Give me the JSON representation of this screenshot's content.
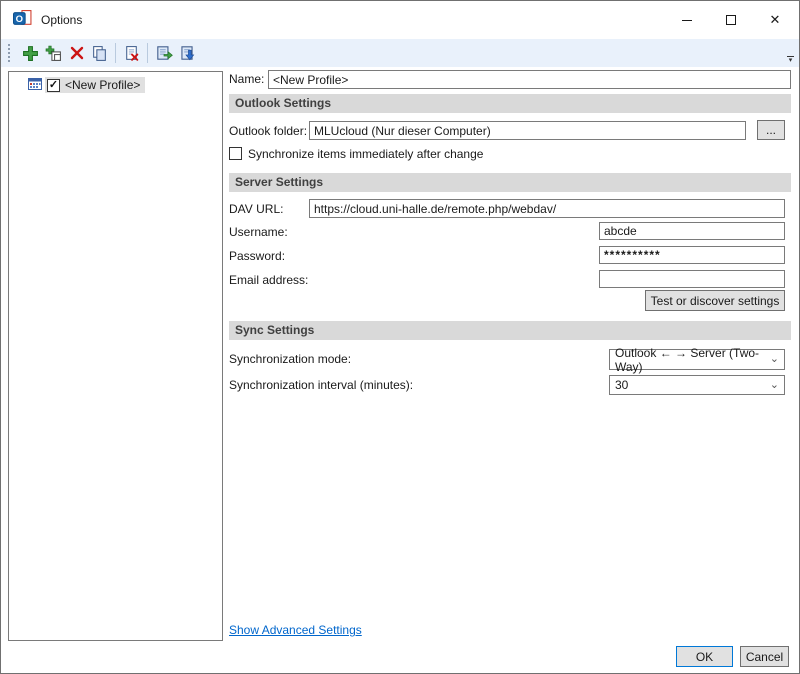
{
  "icons": {
    "check": "✓",
    "chevron_down": "⌄",
    "overflow_arrow": "▾",
    "minimize": "",
    "close": "✕"
  },
  "titlebar": {
    "title": "Options"
  },
  "toolbar": {
    "buttons": [
      {
        "name": "add-profile-icon"
      },
      {
        "name": "add-multiple-profiles-icon"
      },
      {
        "name": "delete-profile-icon"
      },
      {
        "name": "copy-profile-icon"
      },
      {
        "name": "clear-cache-icon"
      },
      {
        "name": "export-profiles-icon"
      },
      {
        "name": "import-profiles-icon"
      }
    ]
  },
  "profiles_panel": {
    "items": [
      {
        "label": "<New Profile>",
        "checked": true
      }
    ]
  },
  "form": {
    "name_label": "Name:",
    "name_value": "<New Profile>",
    "outlook": {
      "title": "Outlook Settings",
      "folder_label": "Outlook folder:",
      "folder_value": "MLUcloud (Nur dieser Computer)",
      "browse_label": "...",
      "sync_immediately_label": "Synchronize items immediately after change",
      "sync_immediately_checked": false
    },
    "server": {
      "title": "Server Settings",
      "dav_url_label": "DAV URL:",
      "dav_url_value": "https://cloud.uni-halle.de/remote.php/webdav/",
      "username_label": "Username:",
      "username_value": "abcde",
      "password_label": "Password:",
      "password_value": "**********",
      "email_label": "Email address:",
      "email_value": "",
      "test_button_label": "Test or discover settings"
    },
    "sync": {
      "title": "Sync Settings",
      "mode_label": "Synchronization mode:",
      "mode_value": "Outlook ← → Server (Two-Way)",
      "interval_label": "Synchronization interval (minutes):",
      "interval_value": "30"
    },
    "advanced_link_label": "Show Advanced Settings"
  },
  "footer": {
    "ok_label": "OK",
    "cancel_label": "Cancel"
  },
  "colors": {
    "toolbar_bg": "#e9f1fb",
    "section_header_bg": "#d9d9d9",
    "selection_bg": "#e0e0e0",
    "accent_blue": "#0078d7",
    "link_blue": "#0066cc",
    "add_green": "#43a047",
    "delete_red": "#cc1414",
    "doc_blue": "#44618f"
  }
}
